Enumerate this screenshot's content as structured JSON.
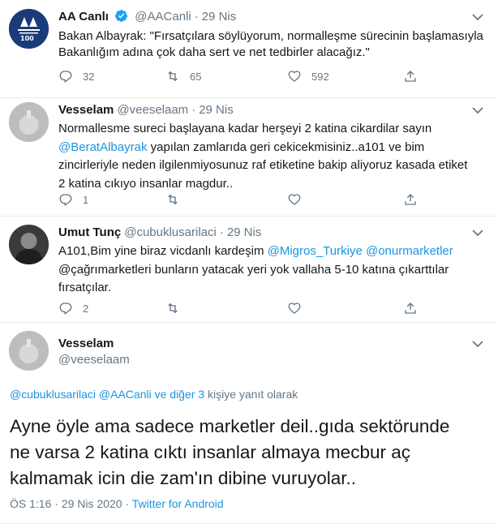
{
  "thread": [
    {
      "name": "AA Canlı",
      "handle": "@AACanli",
      "date": "29 Nis",
      "verified": true,
      "avatar_label": "ANADOLU AJANSI 100 YIL",
      "text_lines": [
        "Bakan Albayrak: \"Fırsatçılara söylüyorum, normalleşme sürecinin başlamasıyla",
        "Bakanlığım adına çok daha sert ve net tedbirler alacağız.\""
      ],
      "replies": "32",
      "retweets": "65",
      "likes": "592"
    },
    {
      "name": "Vesselam",
      "handle": "@veeselaam",
      "date": "29 Nis",
      "text_line1": "Normallesme sureci başlayana kadar herşeyi 2 katina cikardilar sayın",
      "mention": "@BeratAlbayrak",
      "text_line2_rest": " yapılan zamlarıda geri cekicekmisiniz..a101 ve bim",
      "text_line3": "zincirleriyle neden ilgilenmiyosunuz raf etiketine bakip aliyoruz kasada etiket",
      "text_line4": "2 katina cıkıyo insanlar magdur..",
      "replies": "1",
      "retweets": "",
      "likes": ""
    },
    {
      "name": "Umut Tunç",
      "handle": "@cubuklusarilaci",
      "date": "29 Nis",
      "text_line1_pre": "A101,Bim yine biraz vicdanlı kardeşim ",
      "mention1": "@Migros_Turkiye",
      "mention2": "@onurmarketler",
      "text_line2": "@çağrımarketleri bunların yatacak yeri yok vallaha 5-10 katına çıkarttılar",
      "text_line3": "fırsatçılar.",
      "replies": "2",
      "retweets": "",
      "likes": ""
    }
  ],
  "focused": {
    "name": "Vesselam",
    "handle": "@veeselaam",
    "reply_to_links": "@cubuklusarilaci @AACanli ve diğer 3",
    "reply_to_suffix": " kişiye yanıt olarak",
    "text_lines": [
      "Ayne öyle ama sadece marketler deil..gıda sektörunde",
      "ne varsa 2 katina cıktı insanlar almaya mecbur aç",
      "kalmamak icin die zam'ın dibine vuruyolar.."
    ],
    "time": "ÖS 1:16",
    "sep": " · ",
    "date": "29 Nis 2020",
    "source": "Twitter for Android"
  },
  "colors": {
    "link": "#1b95e0",
    "secondary": "#657786",
    "divider": "#e6ecf0",
    "verified": "#1da1f2"
  },
  "icons": [
    "reply-icon",
    "retweet-icon",
    "like-icon",
    "share-icon",
    "chevron-down-icon",
    "verified-icon"
  ]
}
